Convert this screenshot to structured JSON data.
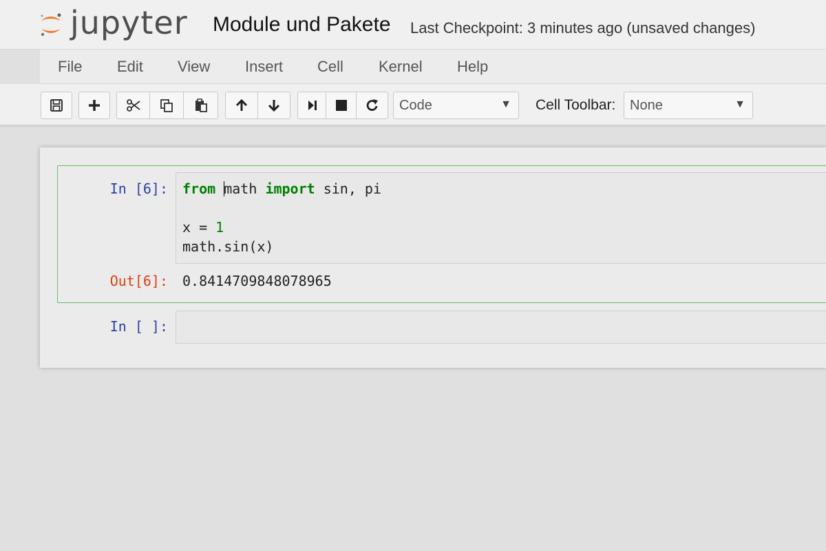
{
  "header": {
    "logo_text": "jupyter",
    "notebook_title": "Module und Pakete",
    "checkpoint": "Last Checkpoint: 3 minutes ago (unsaved changes)"
  },
  "menu": [
    "File",
    "Edit",
    "View",
    "Insert",
    "Cell",
    "Kernel",
    "Help"
  ],
  "toolbar": {
    "buttons": [
      "save-icon",
      "plus-icon",
      "cut-icon",
      "copy-icon",
      "paste-icon",
      "arrow-up-icon",
      "arrow-down-icon",
      "run-icon",
      "stop-icon",
      "restart-icon"
    ],
    "cell_type": "Code",
    "cell_toolbar_label": "Cell Toolbar:",
    "cell_toolbar_value": "None"
  },
  "cells": [
    {
      "in_prompt": "In [6]:",
      "code": {
        "kw_from": "from",
        "mod": "math",
        "kw_import": "import",
        "names": " sin, pi",
        "assign": "x = ",
        "value": "1",
        "call": "math.sin(x)"
      },
      "out_prompt": "Out[6]:",
      "output": "0.8414709848078965"
    },
    {
      "in_prompt": "In [ ]:"
    }
  ],
  "colors": {
    "keyword": "#008000",
    "in_prompt": "#303f9f",
    "out_prompt": "#d84315",
    "selected_border": "#66bb6a",
    "logo_orange": "#f37726"
  }
}
